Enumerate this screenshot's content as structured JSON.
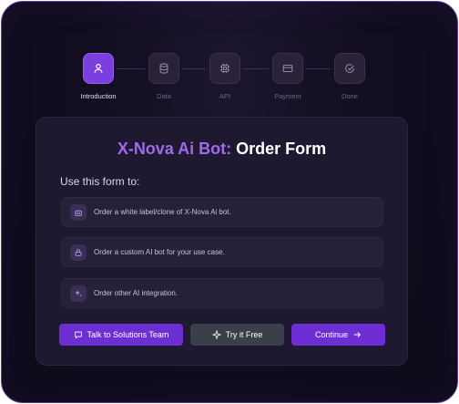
{
  "steps": [
    {
      "label": "Introduction",
      "icon": "user-icon",
      "active": true
    },
    {
      "label": "Data",
      "icon": "database-icon",
      "active": false
    },
    {
      "label": "API",
      "icon": "chip-icon",
      "active": false
    },
    {
      "label": "Payment",
      "icon": "credit-card-icon",
      "active": false
    },
    {
      "label": "Done",
      "icon": "check-circle-icon",
      "active": false
    }
  ],
  "form": {
    "title_accent": "X-Nova Ai Bot:",
    "title_rest": " Order Form",
    "subtitle": "Use this form to:",
    "options": [
      {
        "text": "Order a white label/clone of X-Nova Ai bot.",
        "icon": "bot-icon"
      },
      {
        "text": "Order a custom AI bot for your use case.",
        "icon": "lock-icon"
      },
      {
        "text": "Order other AI integration.",
        "icon": "sparkles-icon"
      }
    ]
  },
  "actions": {
    "talk": "Talk to Solutions Team",
    "try": "Try it Free",
    "continue": "Continue"
  },
  "colors": {
    "accent": "#a06ae9",
    "primary_button": "#6d2fd4",
    "secondary_button": "#3b3f4a"
  }
}
